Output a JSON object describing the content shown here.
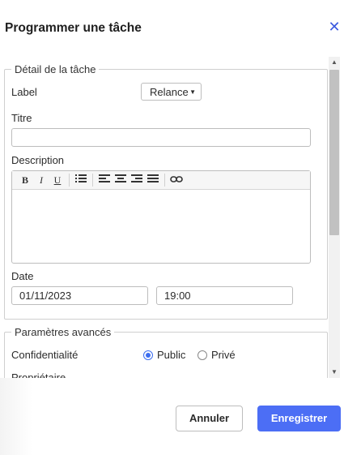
{
  "dialog": {
    "title": "Programmer une tâche",
    "close_icon": "close-icon",
    "accent_color": "#3d5be0"
  },
  "task_details": {
    "legend": "Détail de la tâche",
    "label_label": "Label",
    "label_value": "Relance",
    "title_label": "Titre",
    "title_value": "",
    "description_label": "Description",
    "description_value": "",
    "toolbar": [
      "bold-icon",
      "italic-icon",
      "underline-icon",
      "list-icon",
      "align-left-icon",
      "align-center-icon",
      "align-right-icon",
      "justify-icon",
      "link-icon"
    ],
    "toolbar_glyphs": {
      "bold": "B",
      "italic": "I",
      "underline": "U"
    },
    "date_label": "Date",
    "date_value": "01/11/2023",
    "time_value": "19:00"
  },
  "advanced": {
    "legend": "Paramètres avancés",
    "privacy_label": "Confidentialité",
    "privacy_options": [
      "Public",
      "Privé"
    ],
    "privacy_selected": "Public",
    "owner_label": "Propriétaire"
  },
  "footer": {
    "cancel_label": "Annuler",
    "save_label": "Enregistrer",
    "save_color": "#4c6ef5"
  }
}
